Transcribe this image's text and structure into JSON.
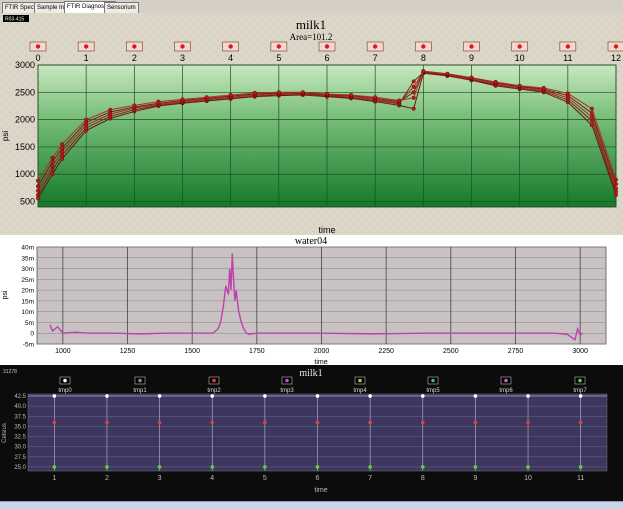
{
  "tabs": [
    "FTIR Spectra",
    "Sample Info",
    "FTIR Diagnostics",
    "Sensorium"
  ],
  "active_tab": 2,
  "panels": {
    "top": {
      "badge": "R03-415",
      "title": "milk1",
      "subtitle": "Area=101.2",
      "marker_labels": [
        "0",
        "1",
        "2",
        "3",
        "4",
        "5",
        "6",
        "7",
        "8",
        "9",
        "10",
        "11",
        "12"
      ],
      "xlabel": "time",
      "ylabel": "psi",
      "yticks": [
        "3000",
        "2500",
        "2000",
        "1500",
        "1000",
        "500"
      ]
    },
    "middle": {
      "title": "water04",
      "xlabel": "time",
      "ylabel": "psi",
      "yticks": [
        "40m",
        "35m",
        "30m",
        "25m",
        "20m",
        "15m",
        "10m",
        "5m",
        "0",
        "-5m"
      ],
      "xticks": [
        "1000",
        "1250",
        "1500",
        "1750",
        "2000",
        "2250",
        "2500",
        "2750",
        "3000"
      ]
    },
    "bottom": {
      "badge": "31278",
      "title": "milk1",
      "legend": [
        {
          "name": "tmp0",
          "color": "#ffffff"
        },
        {
          "name": "tmp1",
          "color": "#8a8a8a"
        },
        {
          "name": "tmp2",
          "color": "#e0403a"
        },
        {
          "name": "tmp3",
          "color": "#c050d0"
        },
        {
          "name": "tmp4",
          "color": "#a0d040"
        },
        {
          "name": "tmp5",
          "color": "#40b0a0"
        },
        {
          "name": "tmp6",
          "color": "#d060c0"
        },
        {
          "name": "tmp7",
          "color": "#60d040"
        }
      ],
      "xlabel": "time",
      "ylabel": "Celsius",
      "yticks": [
        "42.5",
        "40.0",
        "37.5",
        "35.0",
        "32.5",
        "30.0",
        "27.5",
        "25.0"
      ],
      "xticks": [
        "1",
        "2",
        "3",
        "4",
        "5",
        "6",
        "7",
        "8",
        "9",
        "10",
        "11"
      ]
    }
  },
  "chart_data": [
    {
      "type": "line",
      "title": "milk1",
      "subtitle": "Area=101.2",
      "xlabel": "time",
      "ylabel": "psi",
      "ylim": [
        400,
        3000
      ],
      "marker_labels": [
        "0",
        "1",
        "2",
        "3",
        "4",
        "5",
        "6",
        "7",
        "8",
        "9",
        "10",
        "11",
        "12"
      ],
      "x": [
        0,
        0.3,
        0.5,
        1,
        1.5,
        2,
        2.5,
        3,
        3.5,
        4,
        4.5,
        5,
        5.5,
        6,
        6.5,
        7,
        7.5,
        7.8,
        8,
        8.5,
        9,
        9.5,
        10,
        10.5,
        11,
        11.5,
        12
      ],
      "series": [
        {
          "values": [
            560,
            1000,
            1280,
            1800,
            2020,
            2150,
            2250,
            2300,
            2340,
            2380,
            2420,
            2440,
            2450,
            2420,
            2390,
            2330,
            2260,
            2200,
            2850,
            2800,
            2720,
            2620,
            2560,
            2500,
            2320,
            1900,
            620
          ]
        },
        {
          "values": [
            620,
            1080,
            1350,
            1850,
            2060,
            2180,
            2260,
            2310,
            2350,
            2390,
            2430,
            2460,
            2470,
            2440,
            2400,
            2350,
            2290,
            2700,
            2860,
            2810,
            2730,
            2640,
            2580,
            2520,
            2360,
            1980,
            680
          ]
        },
        {
          "values": [
            700,
            1150,
            1420,
            1900,
            2100,
            2210,
            2280,
            2330,
            2370,
            2410,
            2450,
            2480,
            2480,
            2450,
            2420,
            2370,
            2310,
            2600,
            2870,
            2820,
            2740,
            2660,
            2600,
            2540,
            2400,
            2050,
            740
          ]
        },
        {
          "values": [
            780,
            1230,
            1480,
            1950,
            2140,
            2230,
            2300,
            2350,
            2390,
            2430,
            2470,
            2490,
            2490,
            2460,
            2440,
            2390,
            2330,
            2500,
            2880,
            2830,
            2760,
            2680,
            2610,
            2560,
            2440,
            2120,
            820
          ]
        },
        {
          "values": [
            880,
            1300,
            1550,
            2000,
            2180,
            2260,
            2330,
            2370,
            2410,
            2450,
            2490,
            2500,
            2500,
            2470,
            2450,
            2410,
            2350,
            2400,
            2890,
            2840,
            2770,
            2690,
            2620,
            2580,
            2480,
            2200,
            900
          ]
        }
      ]
    },
    {
      "type": "line",
      "title": "water04",
      "xlabel": "time",
      "ylabel": "psi",
      "xlim": [
        900,
        3100
      ],
      "ylim": [
        -5,
        40
      ],
      "x": [
        950,
        960,
        980,
        1000,
        1050,
        1100,
        1200,
        1300,
        1400,
        1500,
        1550,
        1580,
        1600,
        1610,
        1620,
        1630,
        1640,
        1645,
        1650,
        1655,
        1660,
        1665,
        1670,
        1680,
        1690,
        1700,
        1710,
        1720,
        1750,
        1800,
        2000,
        2200,
        2400,
        2600,
        2800,
        2900,
        2950,
        2980,
        2990,
        3000,
        3010
      ],
      "series": [
        {
          "values": [
            4,
            1,
            3,
            0,
            0.5,
            0,
            0,
            -0.3,
            0,
            0,
            0,
            0,
            2,
            5,
            12,
            22,
            18,
            30,
            20,
            37,
            25,
            15,
            20,
            10,
            5,
            2,
            0,
            -0.5,
            0,
            0,
            0,
            -0.3,
            0,
            0,
            0,
            0,
            -0.5,
            -3,
            2,
            -1,
            0
          ]
        }
      ]
    },
    {
      "type": "scatter",
      "title": "milk1",
      "xlabel": "time",
      "ylabel": "Celsius",
      "ylim": [
        24,
        43
      ],
      "x": [
        1,
        2,
        3,
        4,
        5,
        6,
        7,
        8,
        9,
        10,
        11
      ],
      "series": [
        {
          "name": "tmp0",
          "values": [
            42.5,
            42.5,
            42.5,
            42.5,
            42.5,
            42.5,
            42.5,
            42.5,
            42.5,
            42.5,
            42.5
          ]
        },
        {
          "name": "tmp2",
          "values": [
            36,
            36,
            36,
            36,
            36,
            36,
            36,
            36,
            36,
            36,
            36
          ]
        },
        {
          "name": "tmp7",
          "values": [
            25,
            25,
            25,
            25,
            25,
            25,
            25,
            25,
            25,
            25,
            25
          ]
        }
      ]
    }
  ]
}
